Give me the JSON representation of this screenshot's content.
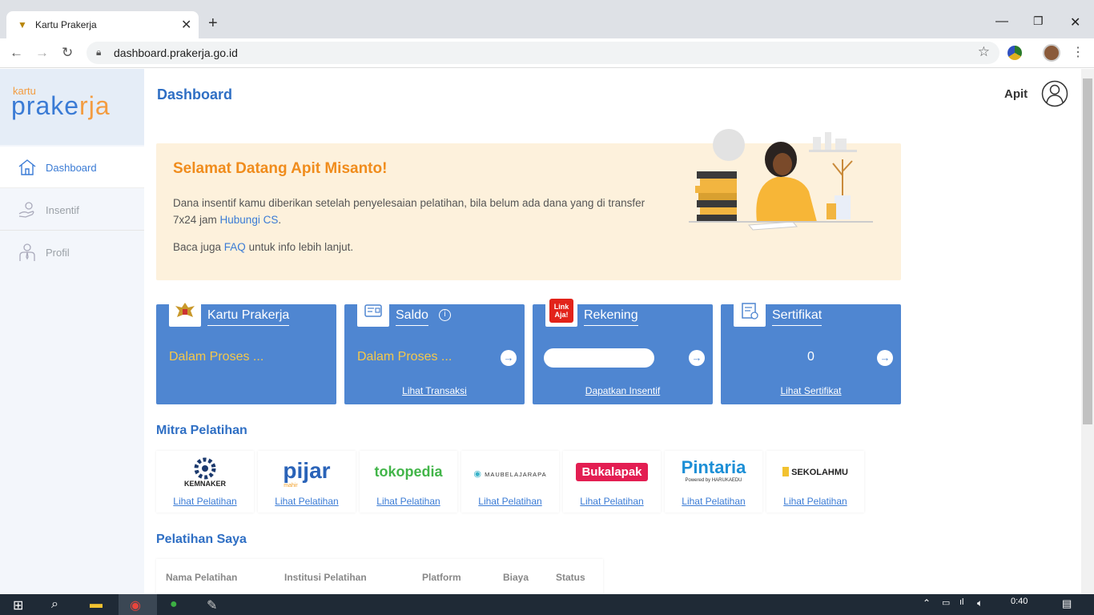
{
  "browser": {
    "tab_title": "Kartu Prakerja",
    "url": "dashboard.prakerja.go.id"
  },
  "logo": {
    "small": "kartu",
    "big_a": "prake",
    "big_b": "rja"
  },
  "sidebar": {
    "items": [
      {
        "label": "Dashboard",
        "icon": "home-icon"
      },
      {
        "label": "Insentif",
        "icon": "hand-coin-icon"
      },
      {
        "label": "Profil",
        "icon": "user-tie-icon"
      }
    ]
  },
  "header": {
    "title": "Dashboard",
    "user_name": "Apit"
  },
  "welcome": {
    "title": "Selamat Datang Apit Misanto!",
    "text_a": "Dana insentif kamu diberikan setelah penyelesaian pelatihan, bila belum ada dana yang di transfer 7x24 jam ",
    "text_link": "Hubungi CS",
    "text_b": ".",
    "faq_a": "Baca juga ",
    "faq_link": "FAQ",
    "faq_b": " untuk info lebih lanjut."
  },
  "cards": {
    "kartu": {
      "title": "Kartu Prakerja",
      "status": "Dalam Proses ..."
    },
    "saldo": {
      "title": "Saldo",
      "info": "i",
      "status": "Dalam Proses ...",
      "link": "Lihat Transaksi"
    },
    "rekening": {
      "title": "Rekening",
      "badge": "Link Aja!",
      "link": "Dapatkan Insentif"
    },
    "sertifikat": {
      "title": "Sertifikat",
      "count": "0",
      "link": "Lihat Sertifikat"
    }
  },
  "mitra": {
    "title": "Mitra Pelatihan",
    "link_label": "Lihat Pelatihan",
    "partners": [
      "KEMNAKER",
      "pijar",
      "tokopedia",
      "MAUBELAJARAPA",
      "Bukalapak",
      "Pintaria",
      "SEKOLAHMU"
    ],
    "pijar_sub": "mahir",
    "pintaria_sub": "Powered by HARUKAEDU"
  },
  "pelatihan": {
    "title": "Pelatihan Saya",
    "columns": [
      "Nama Pelatihan",
      "Institusi Pelatihan",
      "Platform",
      "Biaya",
      "Status"
    ]
  },
  "taskbar": {
    "time": "0:40"
  }
}
